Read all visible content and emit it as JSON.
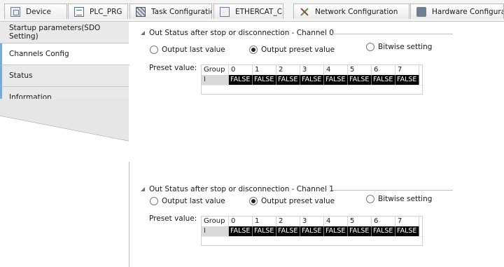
{
  "tabs": [
    {
      "label": "Device",
      "icon": "device-icon"
    },
    {
      "label": "PLC_PRG",
      "icon": "document-icon"
    },
    {
      "label": "Task Configuration",
      "icon": "task-icon"
    },
    {
      "label": "ETHERCAT_C",
      "icon": "ethercat-icon"
    },
    {
      "label": "Network Configuration",
      "icon": "network-icon"
    },
    {
      "label": "Hardware Configuration",
      "icon": "hardware-icon"
    }
  ],
  "sidebar": {
    "items": [
      {
        "label": "Startup parameters(SDO Setting)"
      },
      {
        "label": "Channels Config"
      },
      {
        "label": "Status"
      },
      {
        "label": "Information"
      }
    ],
    "active_item": "Channels Config",
    "accent_color": "#79a9d6"
  },
  "groups": [
    {
      "title": "Out Status after stop or disconnection - Channel 0",
      "radios": [
        {
          "label": "Output last value",
          "checked": false
        },
        {
          "label": "Output preset value",
          "checked": true
        },
        {
          "label": "Bitwise setting",
          "checked": false
        }
      ],
      "preset_label": "Preset value:",
      "grid": {
        "headers": [
          "Group",
          "0",
          "1",
          "2",
          "3",
          "4",
          "5",
          "6",
          "7"
        ],
        "row_label": "I",
        "values": [
          "FALSE",
          "FALSE",
          "FALSE",
          "FALSE",
          "FALSE",
          "FALSE",
          "FALSE",
          "FALSE"
        ]
      }
    },
    {
      "title": "Out Status after stop or disconnection - Channel 1",
      "radios": [
        {
          "label": "Output last value",
          "checked": false
        },
        {
          "label": "Output preset value",
          "checked": true
        },
        {
          "label": "Bitwise setting",
          "checked": false
        }
      ],
      "preset_label": "Preset value:",
      "grid": {
        "headers": [
          "Group",
          "0",
          "1",
          "2",
          "3",
          "4",
          "5",
          "6",
          "7"
        ],
        "row_label": "I",
        "values": [
          "FALSE",
          "FALSE",
          "FALSE",
          "FALSE",
          "FALSE",
          "FALSE",
          "FALSE",
          "FALSE"
        ]
      }
    }
  ],
  "colors": {
    "selected_cell_bg": "#000000",
    "selected_cell_fg": "#ffffff"
  }
}
